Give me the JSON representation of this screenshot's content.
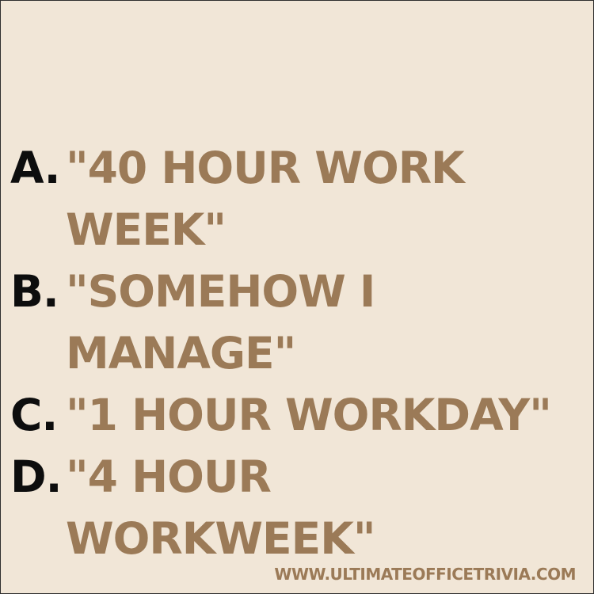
{
  "options": [
    {
      "letter": "A.",
      "text": "\"40 HOUR WORK WEEK\""
    },
    {
      "letter": "B.",
      "text": "\"SOMEHOW I MANAGE\""
    },
    {
      "letter": "C.",
      "text": "\"1 HOUR WORKDAY\""
    },
    {
      "letter": "D.",
      "text": "\"4 HOUR WORKWEEK\""
    }
  ],
  "footer": {
    "url": "WWW.ULTIMATEOFFICETRIVIA.COM"
  },
  "colors": {
    "background": "#f1e6d7",
    "letter": "#0d0d0d",
    "answer": "#9b7a57",
    "border": "#2e2e2e"
  }
}
